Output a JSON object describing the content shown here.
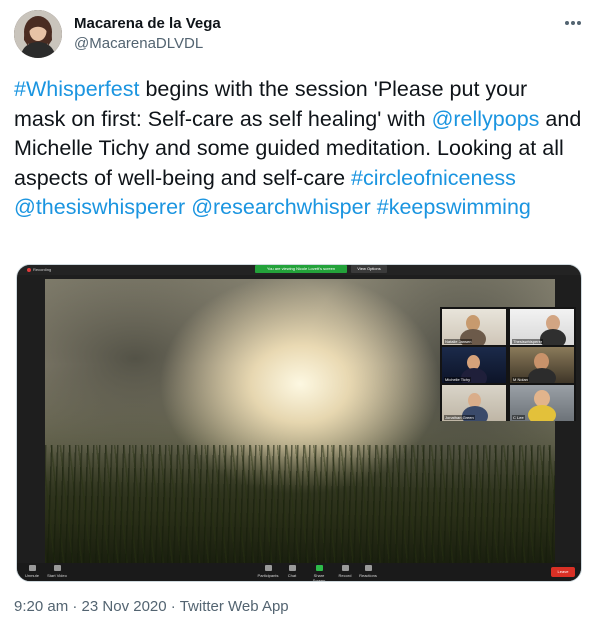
{
  "author": {
    "name": "Macarena de la Vega",
    "handle": "@MacarenaDLVDL"
  },
  "tweet": {
    "segments": [
      {
        "text": "#Whisperfest",
        "type": "hashtag"
      },
      {
        "text": " begins with the session 'Please put your mask on first: Self-care as self healing' with ",
        "type": "text"
      },
      {
        "text": "@rellypops",
        "type": "mention"
      },
      {
        "text": " and Michelle Tichy and some guided meditation. Looking at all aspects of well-being and self-care ",
        "type": "text"
      },
      {
        "text": "#circleofniceness",
        "type": "hashtag"
      },
      {
        "text": " ",
        "type": "text"
      },
      {
        "text": "@thesiswhisperer",
        "type": "mention"
      },
      {
        "text": " ",
        "type": "text"
      },
      {
        "text": "@researchwhisper",
        "type": "mention"
      },
      {
        "text": " ",
        "type": "text"
      },
      {
        "text": "#keepswimming",
        "type": "hashtag"
      }
    ]
  },
  "media": {
    "recording_label": "Recording",
    "green_banner": "You are viewing Nicole Lovett's screen",
    "view_options": "View Options",
    "participants": [
      {
        "label": "Natalie Jansen"
      },
      {
        "label": "Thesiswhisperer"
      },
      {
        "label": "Michelle Tichy"
      },
      {
        "label": "M Nolan"
      },
      {
        "label": "Jonathan Green"
      },
      {
        "label": "C Lee"
      }
    ],
    "toolbar": {
      "mute": "Unmute",
      "video": "Start Video",
      "participants": "Participants",
      "chat": "Chat",
      "share": "Share Screen",
      "record": "Record",
      "reactions": "Reactions",
      "end": "Leave"
    }
  },
  "meta": {
    "time": "9:20 am",
    "date": "23 Nov 2020",
    "app": "Twitter Web App",
    "separator": " · "
  },
  "colors": {
    "link": "#1b95e0",
    "text": "#0f1419",
    "muted": "#536471"
  },
  "icons": {
    "more": "more-horizontal-icon"
  }
}
